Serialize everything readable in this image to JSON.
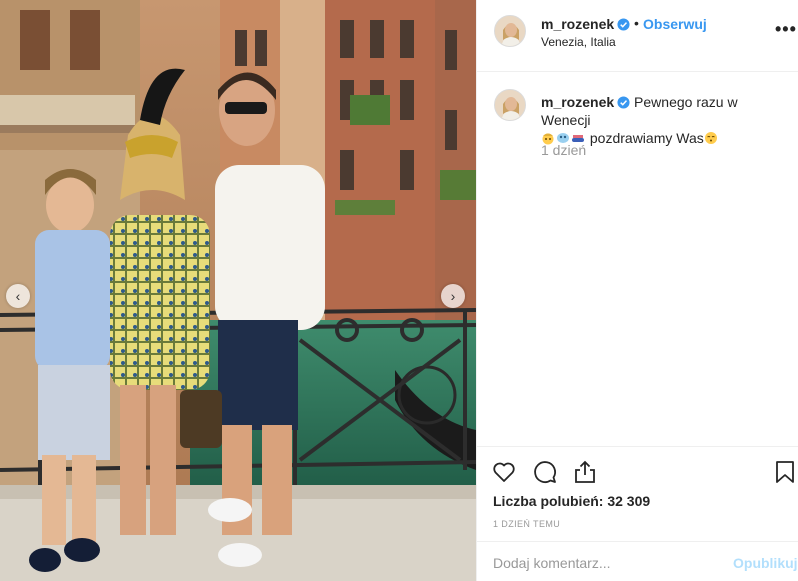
{
  "post": {
    "photo_alt": "Zdjęcie",
    "nav_left_icon": "chevron-left-icon",
    "nav_right_icon": "chevron-right-icon"
  },
  "header": {
    "username": "m_rozenek",
    "separator": "•",
    "follow_label": "Obserwuj",
    "location": "Venezia, Italia",
    "more_label": "•••"
  },
  "caption": {
    "username": "m_rozenek",
    "text_line1": "Pewnego razu w Wenecji",
    "text_line2": "pozdrawiamy Was",
    "time": "1 dzień"
  },
  "actions": {
    "likes": "Liczba polubień: 32 309",
    "date": "1 DZIEŃ TEMU",
    "icons": [
      "heart-icon",
      "comment-icon",
      "share-icon",
      "bookmark-icon"
    ]
  },
  "comment_box": {
    "placeholder": "Dodaj komentarz...",
    "publish_label": "Opublikuj"
  },
  "colors": {
    "accent": "#3897f0",
    "verified": "#3897f0",
    "publish_disabled": "#b2dffc",
    "muted": "#999999",
    "border": "#efefef"
  }
}
